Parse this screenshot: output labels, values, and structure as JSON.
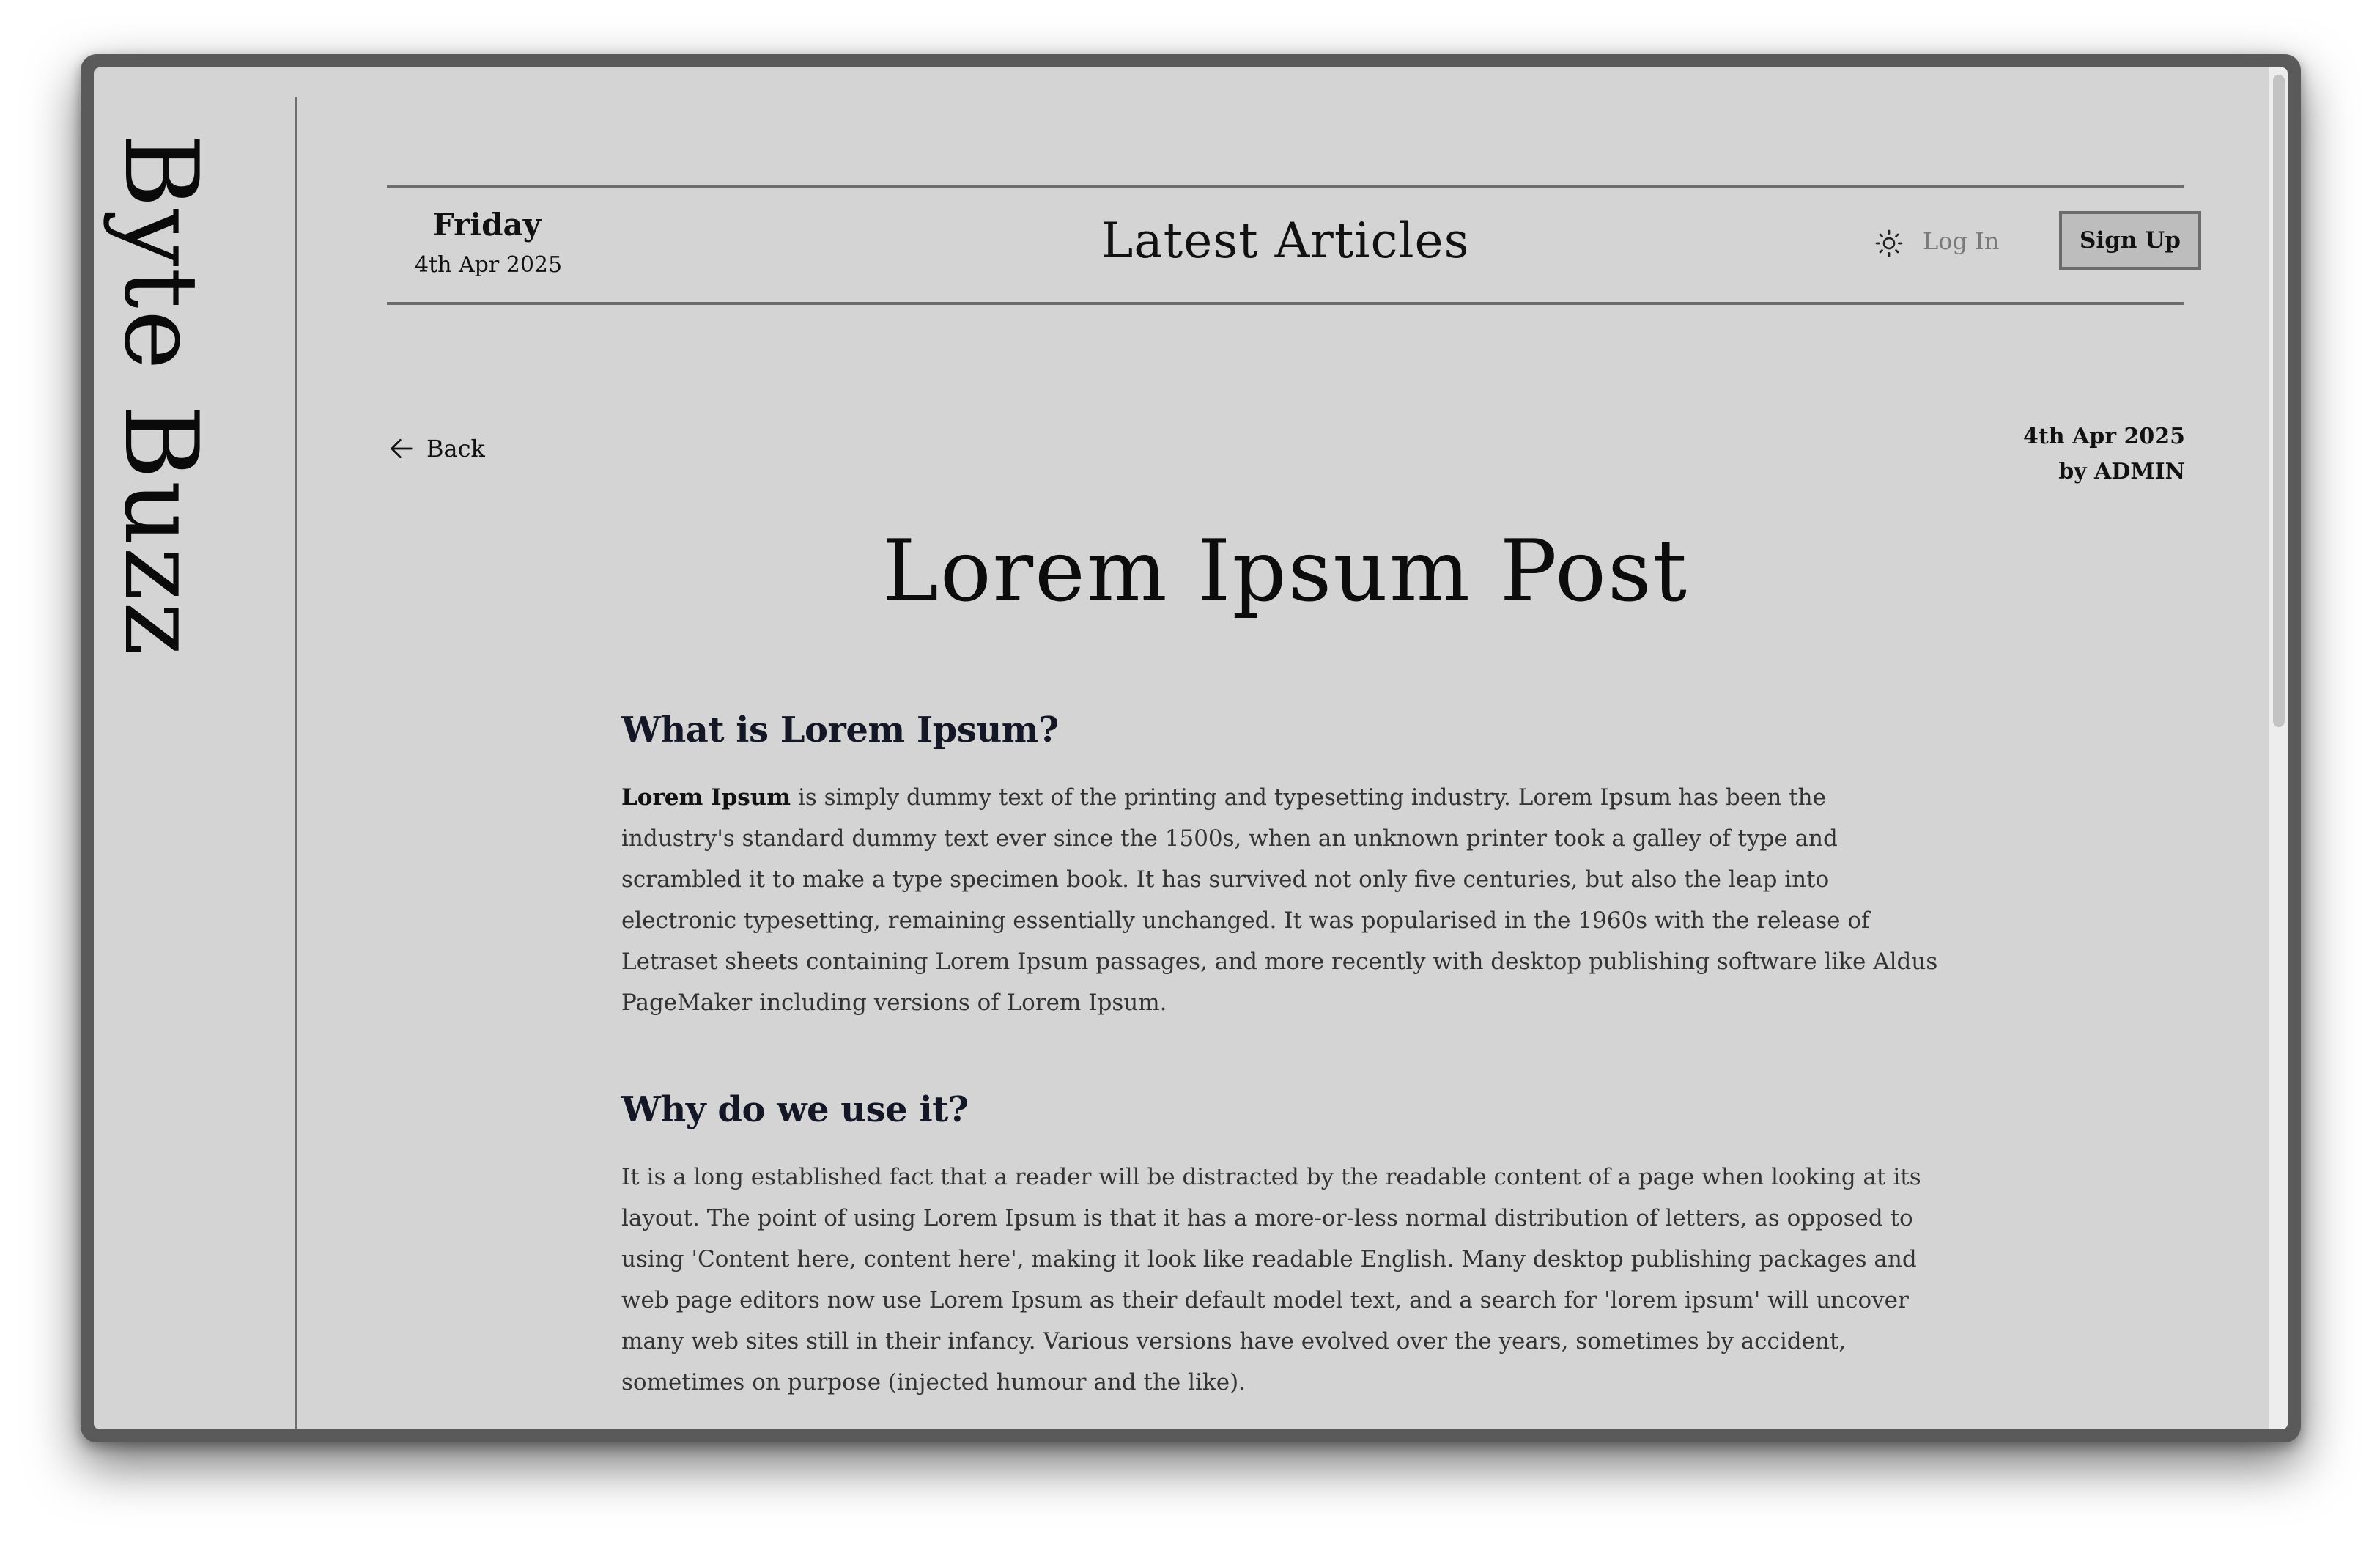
{
  "brand": {
    "name": "Byte Buzz"
  },
  "header": {
    "day": "Friday",
    "date": "4th Apr 2025",
    "title": "Latest Articles",
    "theme_icon": "sun-icon",
    "login_label": "Log In",
    "signup_label": "Sign Up"
  },
  "nav": {
    "back_label": "Back",
    "back_icon": "arrow-left-icon"
  },
  "post": {
    "date": "4th Apr 2025",
    "author": "by ADMIN",
    "title": "Lorem Ipsum Post",
    "sections": [
      {
        "heading": "What is Lorem Ipsum?",
        "lead": "Lorem Ipsum",
        "body": " is simply dummy text of the printing and typesetting industry. Lorem Ipsum has been the industry's standard dummy text ever since the 1500s, when an unknown printer took a galley of type and scrambled it to make a type specimen book. It has survived not only five centuries, but also the leap into electronic typesetting, remaining essentially unchanged. It was popularised in the 1960s with the release of Letraset sheets containing Lorem Ipsum passages, and more recently with desktop publishing software like Aldus PageMaker including versions of Lorem Ipsum."
      },
      {
        "heading": "Why do we use it?",
        "body": "It is a long established fact that a reader will be distracted by the readable content of a page when looking at its layout. The point of using Lorem Ipsum is that it has a more-or-less normal distribution of letters, as opposed to using 'Content here, content here', making it look like readable English. Many desktop publishing packages and web page editors now use Lorem Ipsum as their default model text, and a search for 'lorem ipsum' will uncover many web sites still in their infancy. Various versions have evolved over the years, sometimes by accident, sometimes on purpose (injected humour and the like)."
      }
    ]
  }
}
